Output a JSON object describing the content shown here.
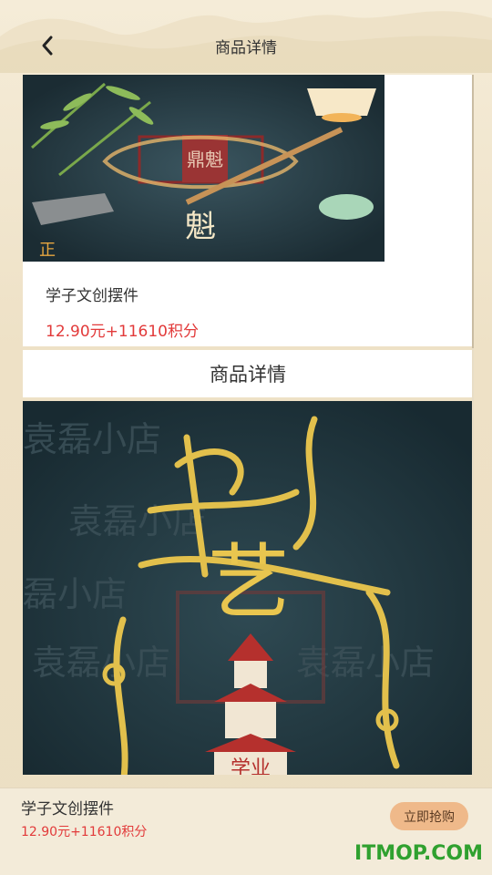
{
  "header": {
    "title": "商品详情"
  },
  "product": {
    "name": "学子文创摆件",
    "price": "12.90元+11610积分",
    "image_text": {
      "main_char": "魁",
      "corner_char": "正",
      "seal": "鼎魁"
    }
  },
  "detail_section": {
    "title": "商品详情",
    "image_text": {
      "main_char": "艺",
      "tower_text": "学业",
      "background_words": [
        "袁磊小店",
        "袁磊小店",
        "磊小店",
        "袁磊小店",
        "袁磊小店"
      ]
    }
  },
  "bottom_bar": {
    "name": "学子文创摆件",
    "price": "12.90元+11610积分",
    "buy_label": "立即抢购"
  },
  "watermark": "ITMOP.COM",
  "colors": {
    "price_red": "#e23a3a",
    "buy_button": "#efb98a",
    "page_bg": "#efe4cc",
    "watermark_green": "#2fa12f"
  }
}
